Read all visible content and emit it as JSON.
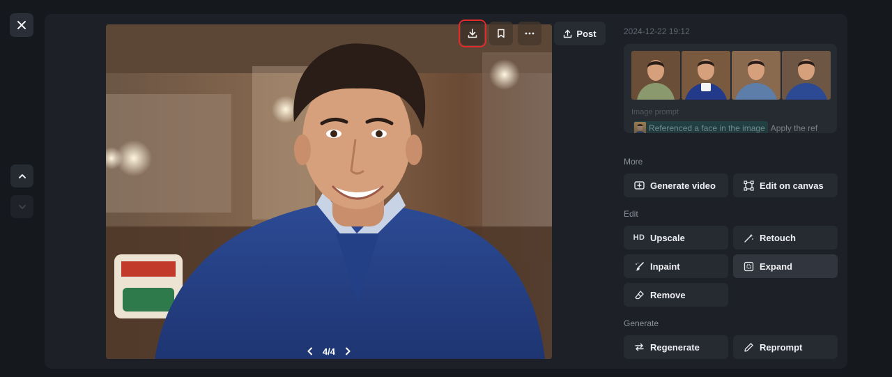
{
  "window": {
    "close_icon": "close-icon",
    "nav_up_icon": "chevron-up-icon",
    "nav_down_icon": "chevron-down-icon"
  },
  "toolbar": {
    "download_icon": "download-icon",
    "bookmark_icon": "bookmark-icon",
    "more_icon": "more-horizontal-icon",
    "post_label": "Post"
  },
  "viewer": {
    "pager_text": "4/4"
  },
  "details": {
    "timestamp": "2024-12-22 19:12",
    "image_prompt_label": "Image prompt",
    "reference_chip_text": "Referenced a face in the image",
    "prompt_text": "Apply the ref"
  },
  "more": {
    "label": "More",
    "generate_video": "Generate video",
    "edit_on_canvas": "Edit on canvas"
  },
  "edit": {
    "label": "Edit",
    "hd_badge": "HD",
    "upscale": "Upscale",
    "retouch": "Retouch",
    "inpaint": "Inpaint",
    "expand": "Expand",
    "remove": "Remove"
  },
  "generate": {
    "label": "Generate",
    "regenerate": "Regenerate",
    "reprompt": "Reprompt"
  },
  "colors": {
    "background": "#15181d",
    "panel": "#1d2027",
    "button": "#262a31",
    "highlight_outline": "#e02a2a",
    "chip": "#1f4a4c"
  }
}
